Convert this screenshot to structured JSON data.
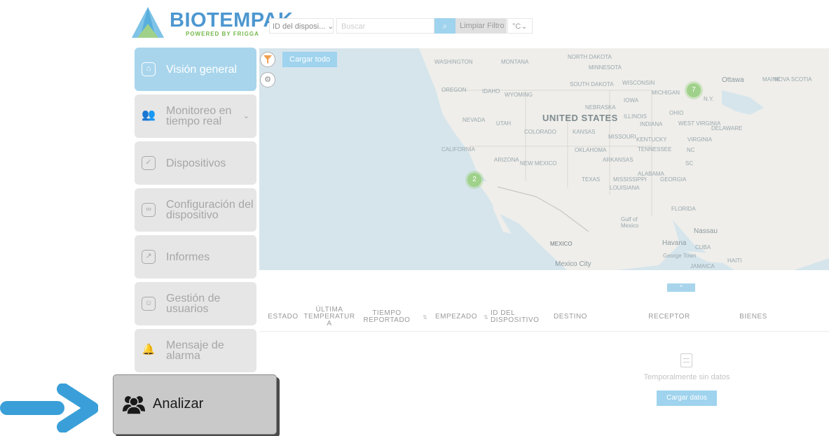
{
  "header": {
    "logo_brand": "BIOTEMPAK",
    "logo_sub": "POWERED BY FRIGGA",
    "device_select": "ID del disposi...",
    "search_placeholder": "Buscar",
    "clear_filter": "Limpiar Filtro",
    "unit": "°C"
  },
  "sidebar": {
    "items": [
      {
        "label": "Visión general",
        "icon": "home-icon",
        "active": true
      },
      {
        "label": "Monitoreo en\ntiempo real",
        "icon": "users-icon",
        "has_chevron": true
      },
      {
        "label": "Dispositivos",
        "icon": "check-icon"
      },
      {
        "label": "Configuración del\ndispositivo",
        "icon": "link-icon"
      },
      {
        "label": "Informes",
        "icon": "chart-line-icon"
      },
      {
        "label": "Gestión de\nusuarios",
        "icon": "user-icon"
      },
      {
        "label": "Mensaje de\nalarma",
        "icon": "bell-icon"
      }
    ]
  },
  "map": {
    "load_all": "Cargar todo",
    "clusters": [
      "7",
      "2"
    ],
    "labels": {
      "washington": "WASHINGTON",
      "montana": "MONTANA",
      "north_dakota": "NORTH DAKOTA",
      "minnesota": "MINNESOTA",
      "oregon": "OREGON",
      "idaho": "IDAHO",
      "wyoming": "WYOMING",
      "south_dakota": "SOUTH DAKOTA",
      "wisconsin": "WISCONSIN",
      "michigan": "MICHIGAN",
      "iowa": "IOWA",
      "nebraska": "NEBRASKA",
      "nevada": "NEVADA",
      "utah": "UTAH",
      "united_states": "UNITED STATES",
      "illinois": "ILLINOIS",
      "ohio": "OHIO",
      "indiana": "INDIANA",
      "colorado": "COLORADO",
      "kansas": "KANSAS",
      "missouri": "MISSOURI",
      "west_virginia": "WEST VIRGINIA",
      "kentucky": "KENTUCKY",
      "virginia": "VIRGINIA",
      "california": "CALIFORNIA",
      "oklahoma": "OKLAHOMA",
      "tennessee": "TENNESSEE",
      "arizona": "ARIZONA",
      "new_mexico": "NEW MEXICO",
      "arkansas": "ARKANSAS",
      "texas": "TEXAS",
      "mississippi": "MISSISSIPPI",
      "alabama": "ALABAMA",
      "georgia": "GEORGIA",
      "louisiana": "LOUISIANA",
      "florida": "FLORIDA",
      "gulf_of_mexico": "Gulf of\nMexico",
      "nassau": "Nassau",
      "mexico": "MEXICO",
      "havana": "Havana",
      "cuba": "CUBA",
      "george_town": "George Town",
      "jamaica": "JAMAICA",
      "haiti": "HAITI",
      "mexico_city": "Mexico City",
      "ottawa": "Ottawa",
      "maine": "MAINE",
      "nova_scotia": "NOVA SCOTIA",
      "ny": "N.Y.",
      "nc": "NC",
      "sc": "SC",
      "delaware": "DELAWARE"
    }
  },
  "table": {
    "columns": [
      "ESTADO",
      "ÚLTIMA\nTEMPERATUR\nA",
      "TIEMPO\nREPORTADO",
      "EMPEZADO",
      "ID DEL\nDISPOSITIVO",
      "DESTINO",
      "RECEPTOR",
      "BIENES"
    ],
    "empty_text": "Temporalmente sin datos",
    "load_data": "Cargar datos"
  },
  "highlight": {
    "label": "Analizar",
    "icon": "users-icon",
    "arrow_color": "#3a9fd8"
  }
}
